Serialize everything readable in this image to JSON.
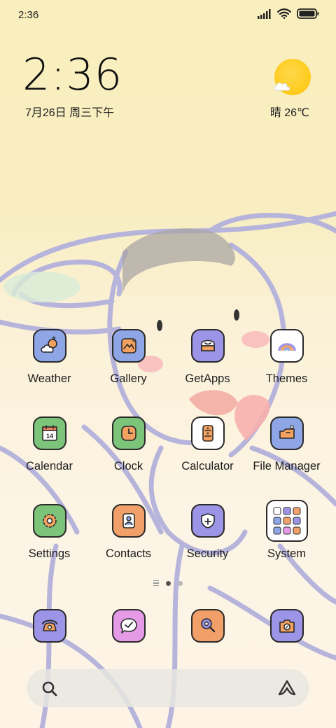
{
  "status_bar": {
    "time": "2:36",
    "icons": [
      "cellular-signal-icon",
      "wifi-icon",
      "battery-icon"
    ]
  },
  "lockscreen_widget": {
    "clock": "2:36",
    "date": "7月26日 周三下午",
    "weather": "晴 26℃",
    "weather_icon": "sunny-partly-cloudy-icon"
  },
  "apps": [
    [
      {
        "label": "Weather",
        "icon": "weather-icon",
        "color": "#8fa6e6"
      },
      {
        "label": "Gallery",
        "icon": "gallery-icon",
        "color": "#8fa6e6"
      },
      {
        "label": "GetApps",
        "icon": "getapps-icon",
        "color": "#9c94e6"
      },
      {
        "label": "Themes",
        "icon": "themes-icon",
        "color": "#ffffff"
      }
    ],
    [
      {
        "label": "Calendar",
        "icon": "calendar-icon",
        "color": "#7cc47a"
      },
      {
        "label": "Clock",
        "icon": "clock-icon",
        "color": "#7cc47a"
      },
      {
        "label": "Calculator",
        "icon": "calculator-icon",
        "color": "#ffffff"
      },
      {
        "label": "File Manager",
        "icon": "file-manager-icon",
        "color": "#8fa6e6"
      }
    ],
    [
      {
        "label": "Settings",
        "icon": "settings-icon",
        "color": "#7cc47a"
      },
      {
        "label": "Contacts",
        "icon": "contacts-icon",
        "color": "#f0a068"
      },
      {
        "label": "Security",
        "icon": "security-icon",
        "color": "#9c94e6"
      },
      {
        "label": "System",
        "icon": "system-folder-icon",
        "color": "#ffffff"
      }
    ]
  ],
  "page_indicator": {
    "pages": 2,
    "active": 0
  },
  "dock": [
    {
      "icon": "phone-icon",
      "color": "#9c94e6"
    },
    {
      "icon": "messages-icon",
      "color": "#e59ae6"
    },
    {
      "icon": "browser-icon",
      "color": "#f0a068"
    },
    {
      "icon": "camera-icon",
      "color": "#9c94e6"
    }
  ],
  "search_bar": {
    "search_icon": "search-icon",
    "assistant_icon": "assistant-icon"
  }
}
